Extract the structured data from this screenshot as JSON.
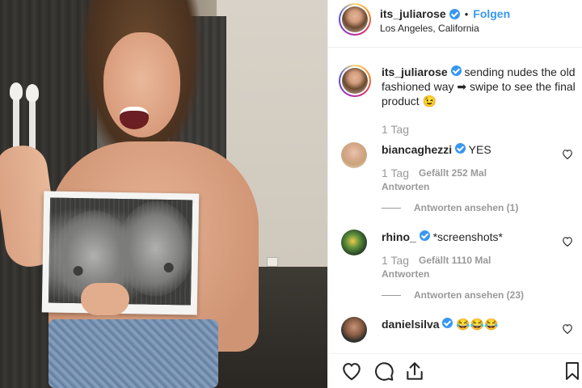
{
  "header": {
    "username": "its_juliarose",
    "separator": "•",
    "follow_label": "Folgen",
    "location": "Los Angeles, California"
  },
  "caption": {
    "username": "its_juliarose",
    "text": "sending nudes the old fashioned way ➡ swipe to see the final product 😉",
    "age": "1 Tag"
  },
  "comments": [
    {
      "username": "biancaghezzi",
      "verified": true,
      "text": "YES",
      "age": "1 Tag",
      "likes": "Gefällt 252 Mal",
      "reply_label": "Antworten",
      "view_replies": "Antworten ansehen (1)"
    },
    {
      "username": "rhino_",
      "verified": true,
      "text": "*screenshots*",
      "age": "1 Tag",
      "likes": "Gefällt 1110 Mal",
      "reply_label": "Antworten",
      "view_replies": "Antworten ansehen (23)"
    },
    {
      "username": "danielsilva",
      "verified": true,
      "text": "😂😂😂"
    }
  ],
  "icons": {
    "like": "heart-icon",
    "comment": "comment-icon",
    "share": "share-icon",
    "save": "bookmark-icon",
    "verified": "verified-badge-icon"
  },
  "colors": {
    "accent": "#3897f0",
    "muted": "#999999",
    "text": "#262626",
    "border": "#efefef"
  }
}
